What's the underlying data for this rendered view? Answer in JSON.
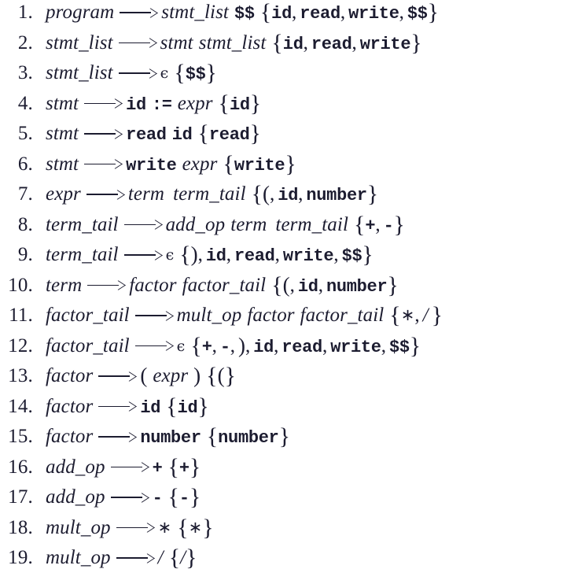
{
  "document": {
    "kind": "grammar-production-list",
    "description": "Numbered LL(1) grammar productions with PREDICT sets",
    "total_rules": 19,
    "background_color": "#ffffff",
    "text_color": "#1c1c30"
  },
  "rules": [
    {
      "number": "1.",
      "lhs": "program",
      "arrow": "⟶",
      "rhs_plain": "stmt_list $$",
      "predict_plain": "{ id, read, write, $$ }",
      "text": "program ⟶ stmt_list $$ {id, read, write, $$}"
    },
    {
      "number": "2.",
      "lhs": "stmt_list",
      "arrow": "⟶",
      "rhs_plain": "stmt stmt_list",
      "predict_plain": "{ id, read, write }",
      "text": "stmt_list ⟶ stmt stmt_list {id, read, write}"
    },
    {
      "number": "3.",
      "lhs": "stmt_list",
      "arrow": "⟶",
      "rhs_plain": "ϵ",
      "predict_plain": "{ $$ }",
      "text": "stmt_list ⟶ ϵ {$$}"
    },
    {
      "number": "4.",
      "lhs": "stmt",
      "arrow": "⟶",
      "rhs_plain": "id := expr",
      "predict_plain": "{ id }",
      "text": "stmt ⟶ id := expr {id}"
    },
    {
      "number": "5.",
      "lhs": "stmt",
      "arrow": "⟶",
      "rhs_plain": "read id",
      "predict_plain": "{ read }",
      "text": "stmt ⟶ read id {read}"
    },
    {
      "number": "6.",
      "lhs": "stmt",
      "arrow": "⟶",
      "rhs_plain": "write expr",
      "predict_plain": "{ write }",
      "text": "stmt ⟶ write expr {write}"
    },
    {
      "number": "7.",
      "lhs": "expr",
      "arrow": "⟶",
      "rhs_plain": "term term_tail",
      "predict_plain": "{ (, id, number }",
      "text": "expr ⟶ term term_tail {(, id, number}"
    },
    {
      "number": "8.",
      "lhs": "term_tail",
      "arrow": "⟶",
      "rhs_plain": "add_op term term_tail",
      "predict_plain": "{ +, - }",
      "text": "term_tail ⟶ add_op term term_tail {+, -}"
    },
    {
      "number": "9.",
      "lhs": "term_tail",
      "arrow": "⟶",
      "rhs_plain": "ϵ",
      "predict_plain": "{ ), id, read, write, $$ }",
      "text": "term_tail ⟶ ϵ {), id, read, write, $$}"
    },
    {
      "number": "10.",
      "lhs": "term",
      "arrow": "⟶",
      "rhs_plain": "factor factor_tail",
      "predict_plain": "{ (, id, number }",
      "text": "term ⟶ factor factor_tail {(, id, number}"
    },
    {
      "number": "11.",
      "lhs": "factor_tail",
      "arrow": "⟶",
      "rhs_plain": "mult_op factor factor_tail",
      "predict_plain": "{ *, / }",
      "text": "factor_tail ⟶ mult_op factor factor_tail {*, /}"
    },
    {
      "number": "12.",
      "lhs": "factor_tail",
      "arrow": "⟶",
      "rhs_plain": "ϵ",
      "predict_plain": "{ +, -, ), id, read, write, $$ }",
      "text": "factor_tail ⟶ ϵ {+, -, ), id, read, write, $$}"
    },
    {
      "number": "13.",
      "lhs": "factor",
      "arrow": "⟶",
      "rhs_plain": "( expr )",
      "predict_plain": "{ ( }",
      "text": "factor ⟶ ( expr ) {(}"
    },
    {
      "number": "14.",
      "lhs": "factor",
      "arrow": "⟶",
      "rhs_plain": "id",
      "predict_plain": "{ id }",
      "text": "factor ⟶ id {id}"
    },
    {
      "number": "15.",
      "lhs": "factor",
      "arrow": "⟶",
      "rhs_plain": "number",
      "predict_plain": "{ number }",
      "text": "factor ⟶ number {number}"
    },
    {
      "number": "16.",
      "lhs": "add_op",
      "arrow": "⟶",
      "rhs_plain": "+",
      "predict_plain": "{ + }",
      "text": "add_op ⟶ + {+}"
    },
    {
      "number": "17.",
      "lhs": "add_op",
      "arrow": "⟶",
      "rhs_plain": "-",
      "predict_plain": "{ - }",
      "text": "add_op ⟶ - {-}"
    },
    {
      "number": "18.",
      "lhs": "mult_op",
      "arrow": "⟶",
      "rhs_plain": "*",
      "predict_plain": "{ * }",
      "text": "mult_op ⟶ * {*}"
    },
    {
      "number": "19.",
      "lhs": "mult_op",
      "arrow": "⟶",
      "rhs_plain": "/",
      "predict_plain": "{ / }",
      "text": "mult_op ⟶ / {/}"
    }
  ],
  "tokens": {
    "lhs_1": "program",
    "lhs_2": "stmt_list",
    "lhs_3": "stmt_list",
    "lhs_4": "stmt",
    "lhs_5": "stmt",
    "lhs_6": "stmt",
    "lhs_7": "expr",
    "lhs_8": "term_tail",
    "lhs_9": "term_tail",
    "lhs_10": "term",
    "lhs_11": "factor_tail",
    "lhs_12": "factor_tail",
    "lhs_13": "factor",
    "lhs_14": "factor",
    "lhs_15": "factor",
    "lhs_16": "add_op",
    "lhs_17": "add_op",
    "lhs_18": "mult_op",
    "lhs_19": "mult_op",
    "nt_stmt_list": "stmt_list",
    "nt_stmt": "stmt",
    "nt_expr": "expr",
    "nt_term": "term",
    "nt_term_tail": "term_tail",
    "nt_factor": "factor",
    "nt_factor_tail": "factor_tail",
    "nt_add_op": "add_op",
    "nt_mult_op": "mult_op",
    "t_id": "id",
    "t_read": "read",
    "t_write": "write",
    "t_number": "number",
    "t_eof": "$$",
    "t_assign": ":=",
    "t_plus": "+",
    "t_minus": "-",
    "t_slash": "/",
    "t_star": "*",
    "sym_epsilon": "ϵ",
    "sym_lparen": "(",
    "sym_rparen": ")",
    "sym_lbrace": "{",
    "sym_rbrace": "}",
    "sym_comma": ",",
    "sym_star_math": "∗",
    "sym_slash_italic": "/"
  }
}
